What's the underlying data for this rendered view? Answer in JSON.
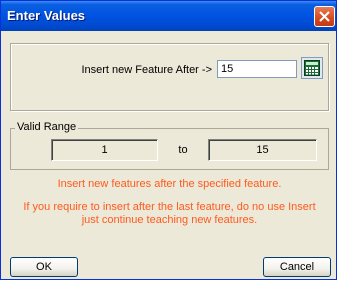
{
  "window": {
    "title": "Enter Values"
  },
  "insert": {
    "label": "Insert new Feature After ->",
    "value": "15"
  },
  "valid_range": {
    "legend": "Valid Range",
    "min": "1",
    "to_label": "to",
    "max": "15"
  },
  "messages": {
    "line1": "Insert new features after the specified feature.",
    "line2": "If you require to insert after the last feature, do no use Insert just continue teaching new features."
  },
  "buttons": {
    "ok": "OK",
    "cancel": "Cancel"
  },
  "colors": {
    "title_bar": "#0054e3",
    "message_text": "#ff5a1f",
    "dialog_bg": "#ece9d8"
  },
  "icons": {
    "close": "close-icon",
    "calculator": "calculator-icon"
  }
}
